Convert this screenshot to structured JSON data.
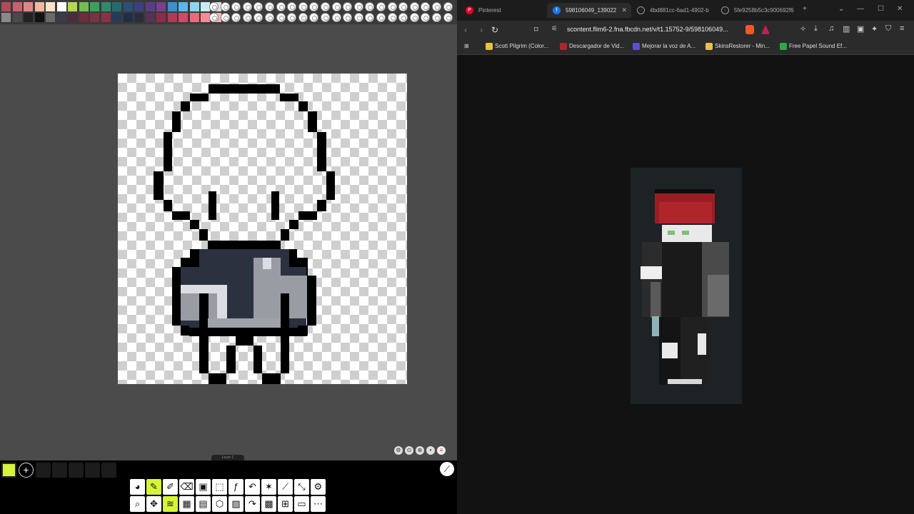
{
  "app": {
    "palette_colors": [
      "#b34a5a",
      "#c96070",
      "#e0868b",
      "#f2b7a0",
      "#fbe3c4",
      "#ffffff",
      "#b6d94a",
      "#6fbf4a",
      "#3aa35b",
      "#2f8a6e",
      "#236b72",
      "#2d4d7a",
      "#3a3f86",
      "#5a3d8a",
      "#7a3f8f",
      "#3d8fd0",
      "#59b6e8",
      "#8fd3f0",
      "#c7ecf8",
      "#dcdcdc",
      "#8a8a8a",
      "#4a4a4a",
      "#222222",
      "#121212",
      "#6a6a6a",
      "#3a3a4a",
      "#4d2b3c",
      "#6b2e3a",
      "#7a3340",
      "#8a3344",
      "#263a5a",
      "#1e3045",
      "#2b2b3e",
      "#553355",
      "#8a2d4a",
      "#b03a55",
      "#d14a63",
      "#e86b7a",
      "#f08d96",
      "#f6b0b5"
    ],
    "layer_label": "Layer 1",
    "colors": {
      "accent": "#d6f536",
      "outline": "#000000",
      "shirt_dark": "#2c3140",
      "shirt_light": "#9a9ca4",
      "shirt_white": "#dcdde2"
    }
  },
  "browser": {
    "tabs": [
      {
        "title": "Pinterest",
        "icon": "pinterest-icon",
        "active": false
      },
      {
        "title": "598106049_139022",
        "icon": "facebook-icon",
        "active": true
      },
      {
        "title": "4bd881cc-6ad1-4902-b",
        "icon": "globe-icon",
        "active": false
      },
      {
        "title": "5fe9258b5c3c900692f6",
        "icon": "globe-icon",
        "active": false
      }
    ],
    "url": "scontent.flim6-2.fna.fbcdn.net/v/t1.15752-9/598106049...",
    "bookmarks": [
      {
        "label": "Scott Pilgrim (Color...",
        "color": "#e8c23a"
      },
      {
        "label": "Descargador de Vid...",
        "color": "#b3222f"
      },
      {
        "label": "Mejorar la voz de A...",
        "color": "#5a4fd6"
      },
      {
        "label": "SkinsRestorer - Min...",
        "color": "#e8c23a"
      },
      {
        "label": "Free Papel Sound Ef...",
        "color": "#2aa84a"
      }
    ]
  }
}
